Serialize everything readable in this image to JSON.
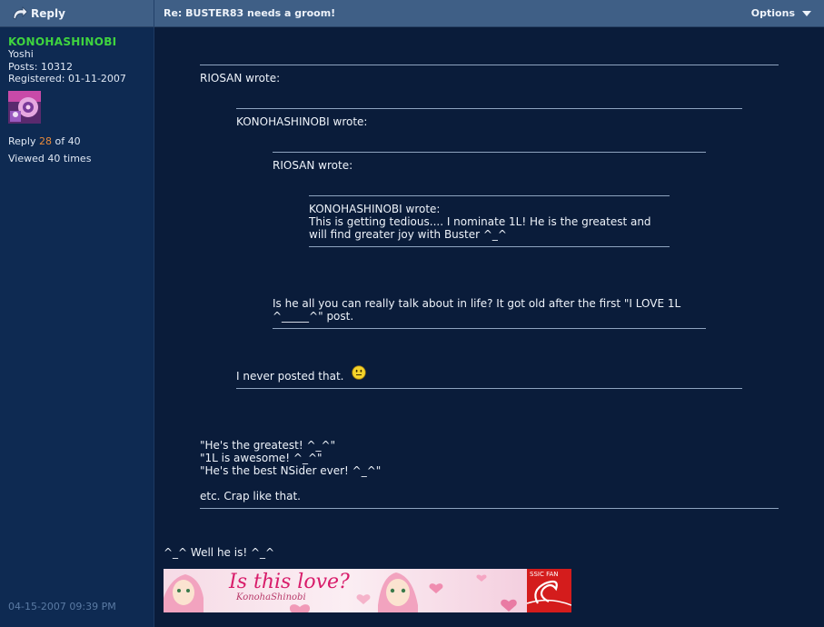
{
  "header": {
    "reply_label": "Reply",
    "thread_title": "Re: BUSTER83 needs a groom!",
    "options_label": "Options"
  },
  "author": {
    "username": "KONOHASHINOBI",
    "rank": "Yoshi",
    "posts": "Posts: 10312",
    "registered": "Registered: 01-11-2007",
    "reply_prefix": "Reply ",
    "reply_number": "28",
    "reply_suffix": " of 40",
    "viewed": "Viewed 40 times",
    "post_date": "04-15-2007 09:39 PM"
  },
  "quotes": {
    "q1_author": "RIOSAN wrote:",
    "q2_author": "KONOHASHINOBI wrote:",
    "q3_author": "RIOSAN wrote:",
    "q4_author": "KONOHASHINOBI wrote:",
    "q4_line1": "This is getting tedious.... I nominate 1L! He is the greatest and",
    "q4_line2": "will find greater joy with Buster ^_^",
    "q3_line1": "Is he all you can really talk about in life? It got old after the first \"I LOVE 1L",
    "q3_line2": "^_____^\" post.",
    "q2_text": "I never posted that.",
    "q1_line1": "\"He's the greatest! ^_^\"",
    "q1_line2": "\"1L is awesome! ^_^\"",
    "q1_line3": "\"He's the best NSider ever! ^_^\"",
    "q1_line4": "etc. Crap like that."
  },
  "reply_text": "^_^ Well he is! ^_^",
  "signature": {
    "title": "Is this love?",
    "subtitle": "KonohaShinobi",
    "badge": "SSIC FAN"
  },
  "colors": {
    "username": "#3fd43f",
    "reply_number": "#e98a3a",
    "header_bg": "#3f5f86",
    "content_bg": "#0a1c3a",
    "sidebar_bg": "#0e2a52"
  },
  "icons": [
    "reply-arrow-icon",
    "dropdown-triangle-icon",
    "smiley-icon"
  ]
}
